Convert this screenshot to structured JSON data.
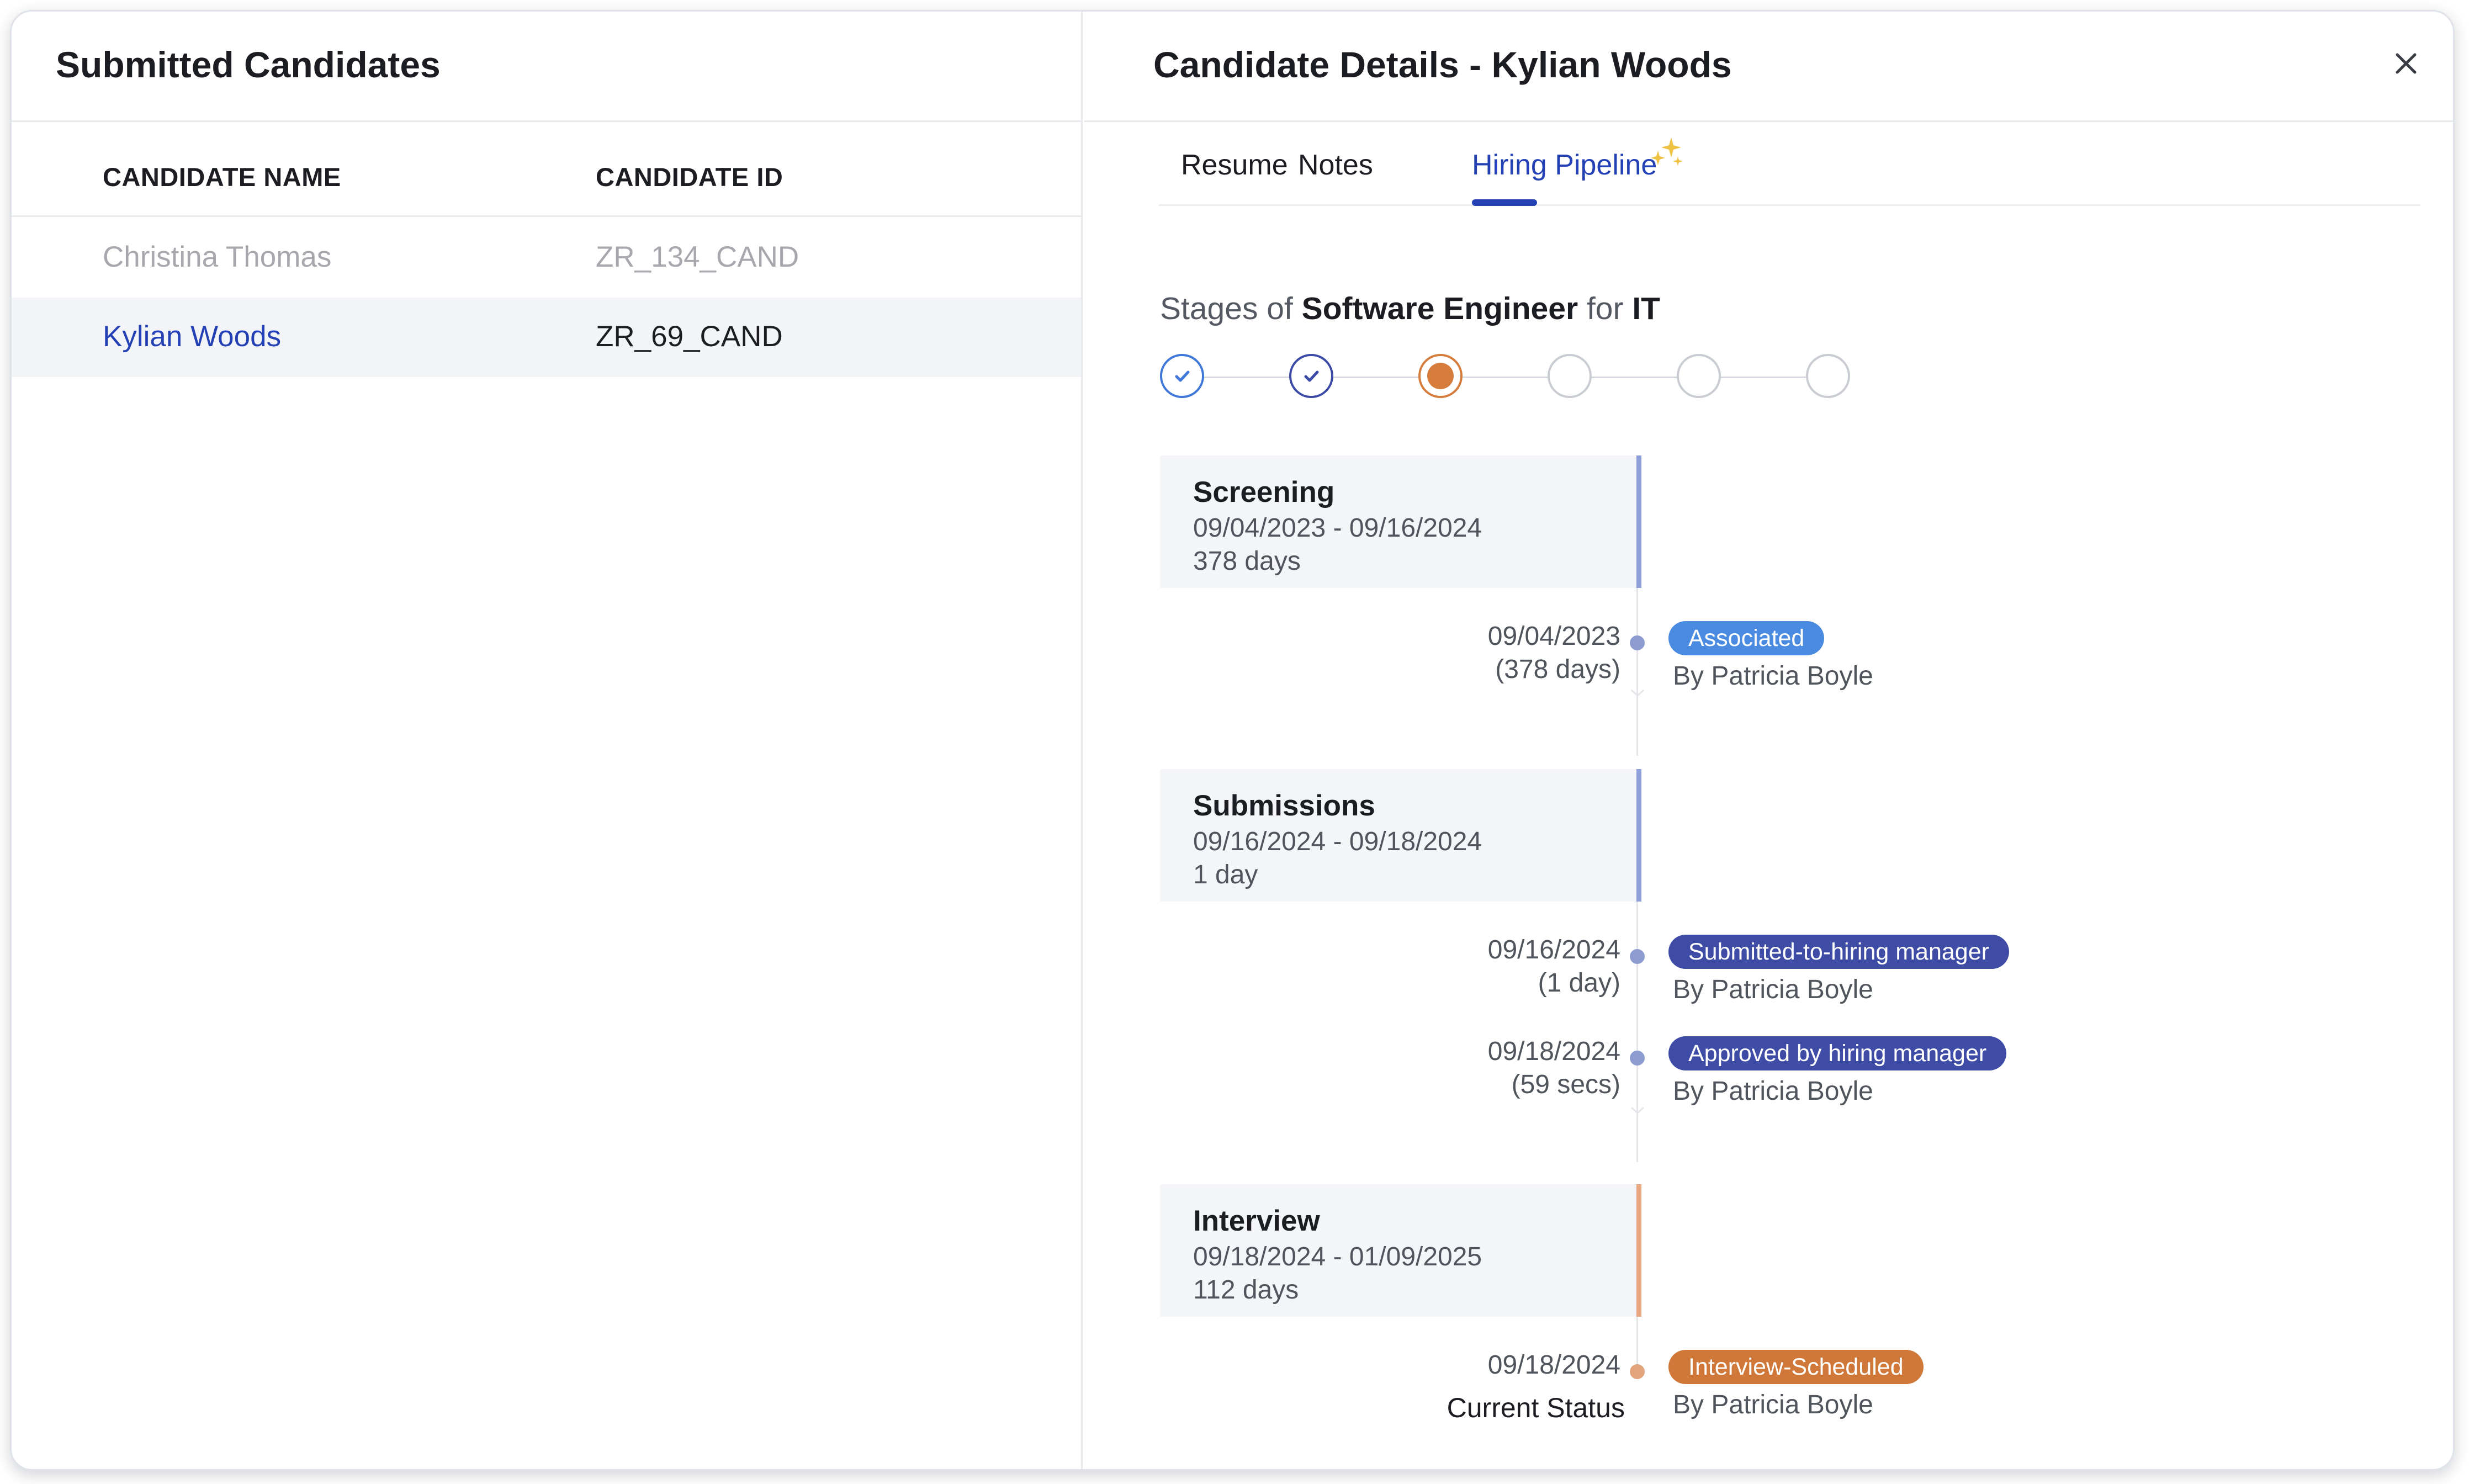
{
  "left": {
    "title": "Submitted Candidates",
    "columns": [
      "CANDIDATE NAME",
      "CANDIDATE ID"
    ],
    "rows": [
      {
        "name": "Christina Thomas",
        "id": "ZR_134_CAND"
      },
      {
        "name": "Kylian Woods",
        "id": "ZR_69_CAND"
      }
    ]
  },
  "right": {
    "title": "Candidate Details - Kylian Woods",
    "tabs": [
      "Resume",
      "Notes",
      "Hiring Pipeline"
    ],
    "active_tab": "Hiring Pipeline",
    "stages_title": {
      "prefix": "Stages of ",
      "job": "Software Engineer",
      "mid": " for ",
      "dept": "IT"
    },
    "progress": [
      "complete",
      "complete",
      "current",
      "pending",
      "pending",
      "pending"
    ],
    "stages": [
      {
        "name": "Screening",
        "range": "09/04/2023 - 09/16/2024",
        "duration": "378 days",
        "events": [
          {
            "date": "09/04/2023",
            "duration": "(378 days)",
            "status": "Associated",
            "by": "By Patricia Boyle"
          }
        ]
      },
      {
        "name": "Submissions",
        "range": "09/16/2024 - 09/18/2024",
        "duration": "1 day",
        "events": [
          {
            "date": "09/16/2024",
            "duration": "(1 day)",
            "status": "Submitted-to-hiring manager",
            "by": "By Patricia Boyle"
          },
          {
            "date": "09/18/2024",
            "duration": "(59 secs)",
            "status": "Approved by hiring manager",
            "by": "By Patricia Boyle"
          }
        ]
      },
      {
        "name": "Interview",
        "range": "09/18/2024 - 01/09/2025",
        "duration": "112 days",
        "events": [
          {
            "date": "09/18/2024",
            "duration": "Current Status",
            "status": "Interview-Scheduled",
            "by": "By Patricia Boyle"
          }
        ]
      }
    ]
  },
  "icons": {
    "close": "close-icon",
    "sparkle": "sparkle-icon",
    "check": "check-icon"
  },
  "colors": {
    "accent": "#2340b5",
    "badge_associated": "#4a8ae0",
    "badge_submission": "#3f4ca6",
    "badge_interview": "#d0783a",
    "stage_bar": "#8f9fdc",
    "stage_bar_current": "#eba682"
  }
}
